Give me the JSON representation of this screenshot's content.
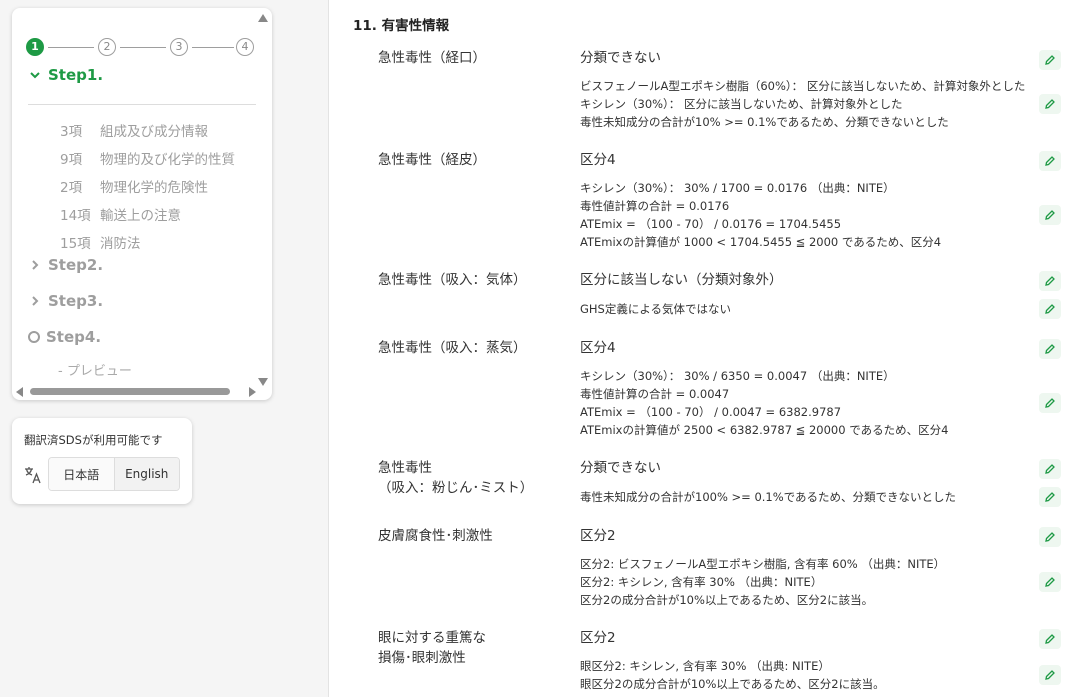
{
  "stepper": {
    "step_numbers": [
      "1",
      "2",
      "3",
      "4"
    ],
    "steps": [
      {
        "label": "Step1.",
        "state": "active-expanded"
      },
      {
        "label": "Step2.",
        "state": "collapsed"
      },
      {
        "label": "Step3.",
        "state": "collapsed"
      },
      {
        "label": "Step4.",
        "state": "pending"
      }
    ],
    "step1_items": [
      {
        "num": "3項",
        "label": "組成及び成分情報"
      },
      {
        "num": "9項",
        "label": "物理的及び化学的性質"
      },
      {
        "num": "2項",
        "label": "物理化学的危険性"
      },
      {
        "num": "14項",
        "label": "輸送上の注意"
      },
      {
        "num": "15項",
        "label": "消防法"
      }
    ],
    "step4_sub": "- プレビュー"
  },
  "translation": {
    "notice": "翻訳済SDSが利用可能です",
    "languages": [
      "日本語",
      "English"
    ],
    "selected": "日本語"
  },
  "section": {
    "title": "11. 有害性情報",
    "rows": [
      {
        "label": [
          "急性毒性（経口）"
        ],
        "classification": "分類できない",
        "notes": [
          "ビスフェノールA型エポキシ樹脂（60%）： 区分に該当しないため、計算対象外とした",
          "キシレン（30%）： 区分に該当しないため、計算対象外とした",
          "毒性未知成分の合計が10% >= 0.1%であるため、分類できないとした"
        ]
      },
      {
        "label": [
          "急性毒性（経皮）"
        ],
        "classification": "区分4",
        "notes": [
          "キシレン（30%）： 30% / 1700 = 0.0176 （出典：NITE）",
          "毒性値計算の合計 = 0.0176",
          "ATEmix = （100 - 70） / 0.0176 = 1704.5455",
          "ATEmixの計算値が 1000 < 1704.5455 ≦ 2000 であるため、区分4"
        ]
      },
      {
        "label": [
          "急性毒性（吸入：気体）"
        ],
        "classification": "区分に該当しない（分類対象外）",
        "notes": [
          "GHS定義による気体ではない"
        ]
      },
      {
        "label": [
          "急性毒性（吸入：蒸気）"
        ],
        "classification": "区分4",
        "notes": [
          "キシレン（30%）： 30% / 6350 = 0.0047 （出典：NITE）",
          "毒性値計算の合計 = 0.0047",
          "ATEmix = （100 - 70） / 0.0047 = 6382.9787",
          "ATEmixの計算値が 2500 < 6382.9787 ≦ 20000 であるため、区分4"
        ]
      },
      {
        "label": [
          "急性毒性",
          "（吸入：粉じん･ミスト）"
        ],
        "classification": "分類できない",
        "notes": [
          "毒性未知成分の合計が100% >= 0.1%であるため、分類できないとした"
        ]
      },
      {
        "label": [
          "皮膚腐食性･刺激性"
        ],
        "classification": "区分2",
        "notes": [
          "区分2: ビスフェノールA型エポキシ樹脂, 含有率 60% （出典：NITE）",
          "区分2: キシレン, 含有率 30% （出典：NITE）",
          "区分2の成分合計が10%以上であるため、区分2に該当。"
        ]
      },
      {
        "label": [
          "眼に対する重篤な",
          "損傷･眼刺激性"
        ],
        "classification": "区分2",
        "notes": [
          "眼区分2: キシレン, 含有率 30% （出典: NITE）",
          "眼区分2の成分合計が10%以上であるため、区分2に該当。"
        ]
      }
    ]
  },
  "colors": {
    "accent": "#1e9a45",
    "muted": "#9e9e9e"
  },
  "icons": {
    "edit": "pencil-icon",
    "translate": "translate-icon"
  }
}
